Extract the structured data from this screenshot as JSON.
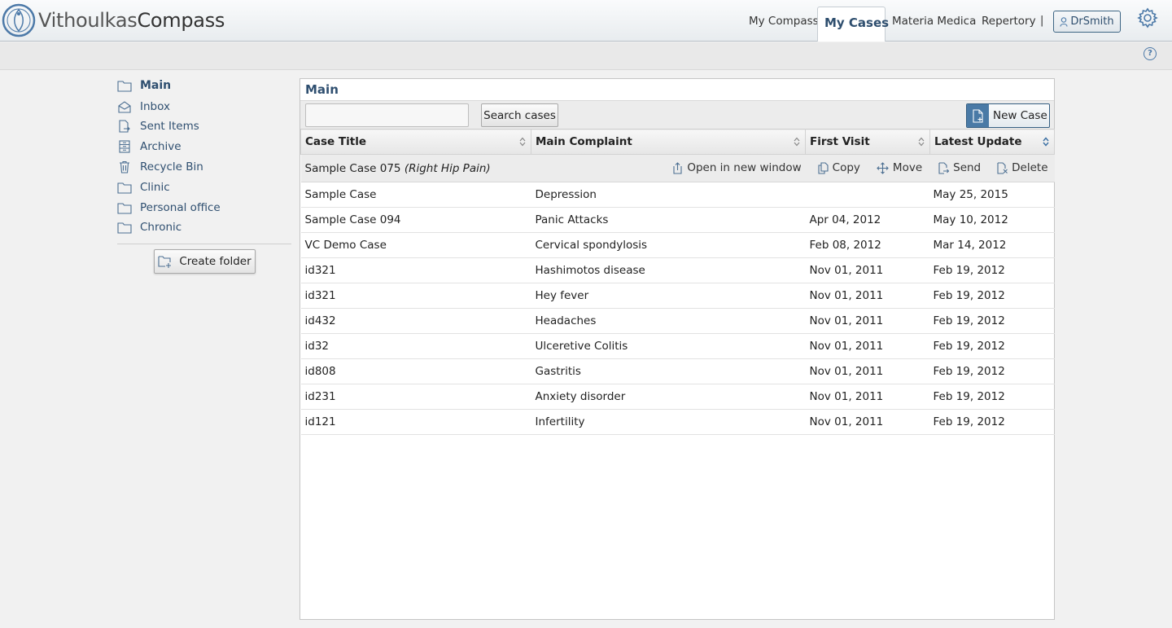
{
  "app": {
    "logo_part1": "Vithoulkas",
    "logo_part2": "Compass"
  },
  "nav": {
    "items": [
      "My Compass",
      "My Cases",
      "Materia Medica",
      "Repertory"
    ],
    "active": "My Cases",
    "separator": "|",
    "user": "DrSmith",
    "settings_icon": "gear-icon",
    "help_icon": "help-icon",
    "help_glyph": "?"
  },
  "sidebar": {
    "items": [
      {
        "label": "Main",
        "icon": "folder-icon"
      },
      {
        "label": "Inbox",
        "icon": "inbox-icon"
      },
      {
        "label": "Sent Items",
        "icon": "sent-icon"
      },
      {
        "label": "Archive",
        "icon": "archive-icon"
      },
      {
        "label": "Recycle Bin",
        "icon": "trash-icon"
      },
      {
        "label": "Clinic",
        "icon": "folder-icon"
      },
      {
        "label": "Personal office",
        "icon": "folder-icon"
      },
      {
        "label": "Chronic",
        "icon": "folder-icon"
      }
    ],
    "create_folder": "Create folder"
  },
  "main": {
    "title": "Main",
    "search_value": "",
    "search_button": "Search cases",
    "new_case_button": "New Case",
    "columns": [
      "Case Title",
      "Main Complaint",
      "First Visit",
      "Latest Update"
    ],
    "selected_row": {
      "title": "Sample Case 075",
      "complaint": "(Right Hip Pain)"
    },
    "row_actions": [
      "Open in new window",
      "Copy",
      "Move",
      "Send",
      "Delete"
    ],
    "rows": [
      {
        "title": "Sample Case",
        "complaint": "Depression",
        "first": "",
        "latest": "May 25, 2015"
      },
      {
        "title": "Sample Case 094",
        "complaint": "Panic Attacks",
        "first": "Apr 04, 2012",
        "latest": "May 10, 2012"
      },
      {
        "title": "VC Demo Case",
        "complaint": "Cervical spondylosis",
        "first": "Feb 08, 2012",
        "latest": "Mar 14, 2012"
      },
      {
        "title": "id321",
        "complaint": "Hashimotos disease",
        "first": "Nov 01, 2011",
        "latest": "Feb 19, 2012"
      },
      {
        "title": "id321",
        "complaint": "Hey fever",
        "first": "Nov 01, 2011",
        "latest": "Feb 19, 2012"
      },
      {
        "title": "id432",
        "complaint": "Headaches",
        "first": "Nov 01, 2011",
        "latest": "Feb 19, 2012"
      },
      {
        "title": "id32",
        "complaint": "Ulceretive Colitis",
        "first": "Nov 01, 2011",
        "latest": "Feb 19, 2012"
      },
      {
        "title": "id808",
        "complaint": "Gastritis",
        "first": "Nov 01, 2011",
        "latest": "Feb 19, 2012"
      },
      {
        "title": "id231",
        "complaint": "Anxiety disorder",
        "first": "Nov 01, 2011",
        "latest": "Feb 19, 2012"
      },
      {
        "title": "id121",
        "complaint": "Infertility",
        "first": "Nov 01, 2011",
        "latest": "Feb 19, 2012"
      }
    ]
  },
  "colors": {
    "brand": "#2f4f70",
    "accent": "#4a7aa6"
  }
}
